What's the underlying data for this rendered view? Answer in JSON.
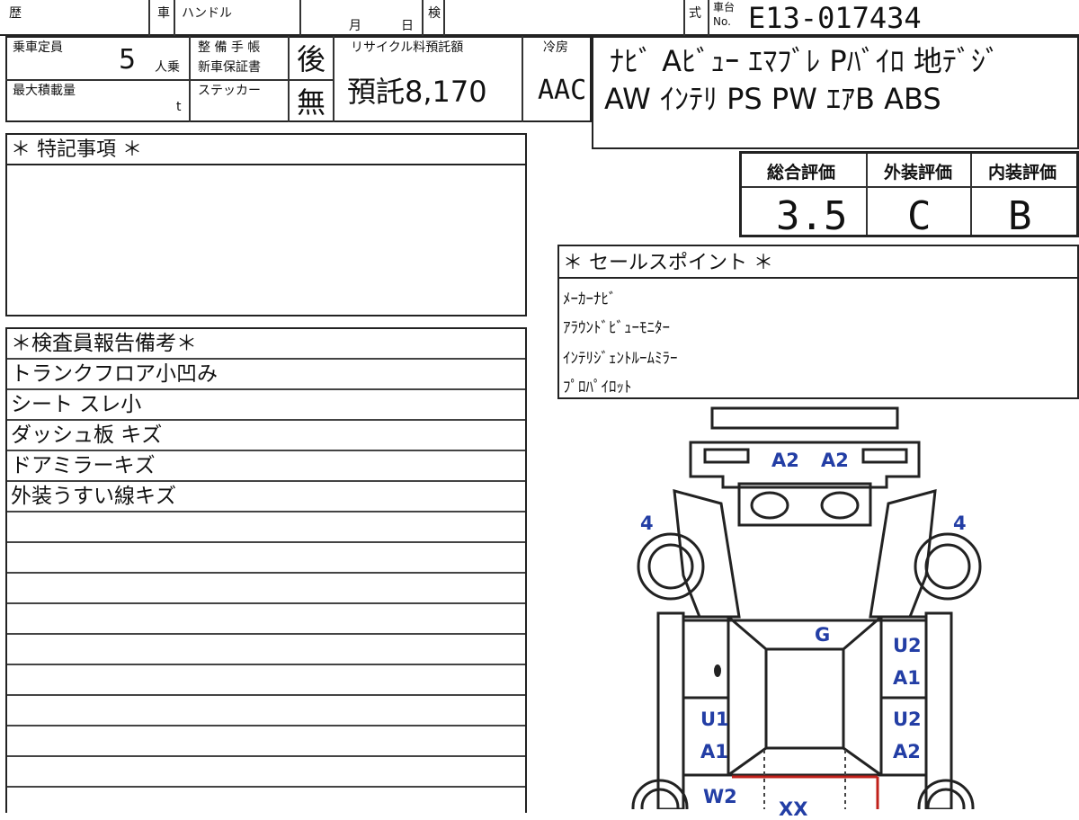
{
  "top_row": {
    "history_label": "歴",
    "car_label": "車",
    "handle_label": "ハンドル",
    "month_label": "月",
    "day_label": "日",
    "inspection_label": "検",
    "type_label": "式",
    "chassis_label_top": "車台",
    "chassis_label_bottom": "No.",
    "chassis_no": "E13-017434"
  },
  "specs": {
    "capacity_label": "乗車定員",
    "capacity_value": "5",
    "capacity_unit": "人乗",
    "max_load_label": "最大積載量",
    "max_load_unit": "t",
    "maintenance_label": "整 備 手 帳",
    "warranty_label": "新車保証書",
    "maintenance_value": "後",
    "sticker_label": "ステッカー",
    "sticker_value": "無",
    "recycle_label": "リサイクル料預託額",
    "recycle_value": "預託8,170",
    "ac_label": "冷房",
    "ac_value": "AAC"
  },
  "equipment": {
    "line1": "ﾅﾋﾞ  Aﾋﾞｭｰ  ｴﾏﾌﾞﾚ  Pﾊﾞｲﾛ  地ﾃﾞｼﾞ",
    "line2": "AW  ｲﾝﾃﾘ  PS  PW  ｴｱB  ABS"
  },
  "special_notes": {
    "title": "＊ 特記事項 ＊"
  },
  "grades": {
    "overall_label": "総合評価",
    "overall_value": "3.5",
    "exterior_label": "外装評価",
    "exterior_value": "C",
    "interior_label": "内装評価",
    "interior_value": "B"
  },
  "sales_points": {
    "title": "＊ セールスポイント ＊",
    "items": [
      "ﾒｰｶｰﾅﾋﾞ",
      "ｱﾗｳﾝﾄﾞﾋﾞｭｰﾓﾆﾀｰ",
      "ｲﾝﾃﾘｼﾞｪﾝﾄﾙｰﾑﾐﾗｰ",
      "ﾌﾟﾛﾊﾟｲﾛｯﾄ"
    ]
  },
  "inspector_report": {
    "title": "＊検査員報告備考＊",
    "items": [
      "トランクフロア小凹み",
      "シート スレ小",
      "ダッシュ板 キズ",
      "ドアミラーキズ",
      "外装うすい線キズ"
    ]
  },
  "damage_marks": {
    "front_left": "A2",
    "front_right": "A2",
    "wheel_left": "4",
    "wheel_right": "4",
    "roof": "G",
    "right_front_door_1": "U2",
    "right_front_door_2": "A1",
    "left_rear_door_1": "U1",
    "left_rear_door_2": "A1",
    "right_rear_door_1": "U2",
    "right_rear_door_2": "A2",
    "rear_left": "W2",
    "rear_mid": "XX"
  },
  "colors": {
    "damage_text": "#233ea5",
    "red_line": "#c0201a",
    "border": "#222222"
  }
}
